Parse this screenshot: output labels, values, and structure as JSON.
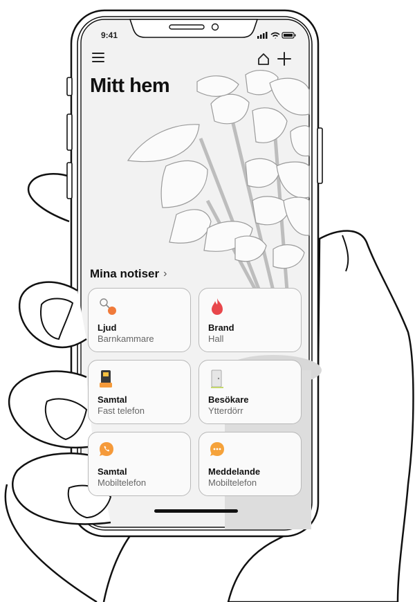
{
  "status": {
    "time": "9:41"
  },
  "header": {
    "title": "Mitt hem",
    "menu_icon": "hamburger-icon",
    "home_icon": "home-icon",
    "add_icon": "plus-icon"
  },
  "notifications": {
    "label": "Mina notiser",
    "cards": [
      {
        "name": "Ljud",
        "place": "Barnkammare",
        "icon": "baby-rattle-icon"
      },
      {
        "name": "Brand",
        "place": "Hall",
        "icon": "flame-icon"
      },
      {
        "name": "Samtal",
        "place": "Fast telefon",
        "icon": "desk-phone-icon"
      },
      {
        "name": "Besökare",
        "place": "Ytterdörr",
        "icon": "door-icon"
      },
      {
        "name": "Samtal",
        "place": "Mobiltelefon",
        "icon": "phone-bubble-icon"
      },
      {
        "name": "Meddelande",
        "place": "Mobiltelefon",
        "icon": "message-bubble-icon"
      }
    ]
  },
  "colors": {
    "accent": "#f79a3e",
    "fire": "#e8474b",
    "phone": "#3a3a3a",
    "screen_bg": "#f2f2f2"
  }
}
